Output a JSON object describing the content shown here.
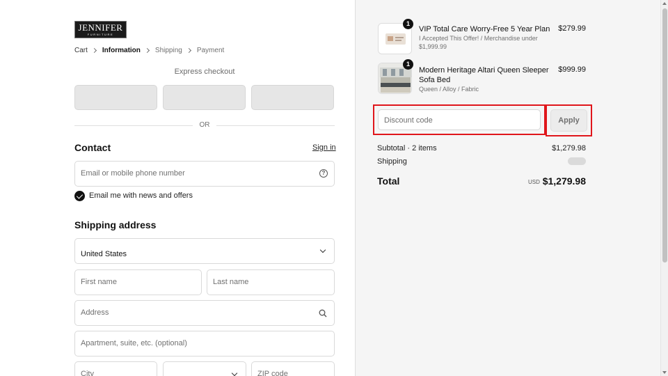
{
  "logo": {
    "line1": "JENNIFER",
    "line2": "FURNITURE"
  },
  "breadcrumb": [
    "Cart",
    "Information",
    "Shipping",
    "Payment"
  ],
  "express": {
    "title": "Express checkout",
    "or": "OR"
  },
  "contact": {
    "title": "Contact",
    "signin": "Sign in",
    "email_placeholder": "Email or mobile phone number",
    "newsletter_label": "Email me with news and offers",
    "newsletter_checked": true
  },
  "shipping": {
    "title": "Shipping address",
    "country_label": "Country/Region",
    "country_value": "United States",
    "first_name_placeholder": "First name",
    "last_name_placeholder": "Last name",
    "address_placeholder": "Address",
    "apartment_placeholder": "Apartment, suite, etc. (optional)",
    "city_placeholder": "City",
    "zip_placeholder": "ZIP code"
  },
  "summary": {
    "items": [
      {
        "qty": "1",
        "name": "VIP Total Care Worry-Free 5 Year Plan",
        "meta": "I Accepted This Offer! / Merchandise under $1,999.99",
        "price": "$279.99"
      },
      {
        "qty": "1",
        "name": "Modern Heritage Altari Queen Sleeper Sofa Bed",
        "meta": "Queen / Alloy / Fabric",
        "price": "$999.99"
      }
    ],
    "discount_placeholder": "Discount code",
    "apply_label": "Apply",
    "subtotal_label": "Subtotal · 2 items",
    "subtotal_value": "$1,279.98",
    "shipping_label": "Shipping",
    "total_label": "Total",
    "currency": "USD",
    "total_value": "$1,279.98"
  },
  "colors": {
    "highlight": "#e0161b",
    "primary": "#111111",
    "panel": "#f5f5f5"
  }
}
